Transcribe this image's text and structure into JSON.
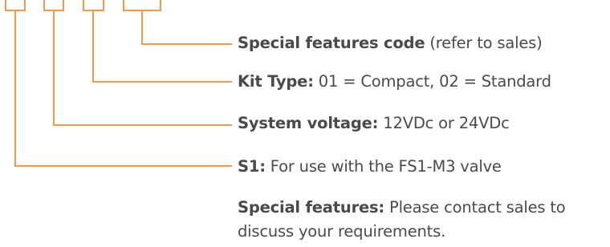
{
  "accent_color": "#f39a4a",
  "text_color": "#4a4a4a",
  "callouts": [
    {
      "key": "Special features code",
      "text": " (refer to sales)"
    },
    {
      "key": "Kit Type:",
      "text": " 01 = Compact, 02 = Standard"
    },
    {
      "key": "System voltage:",
      "text": " 12VDc or 24VDc"
    },
    {
      "key": "S1:",
      "text": " For use with the FS1-M3 valve"
    }
  ],
  "note": {
    "key": "Special features:",
    "text": " Please contact sales to discuss your requirements."
  }
}
